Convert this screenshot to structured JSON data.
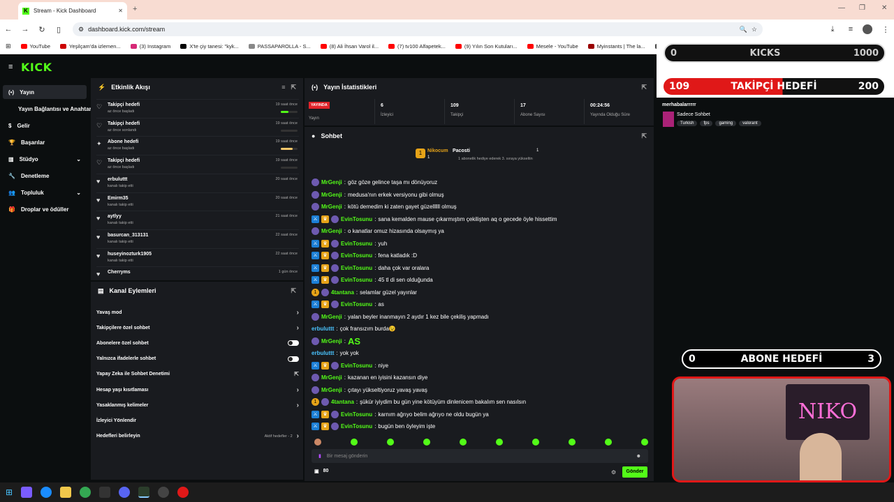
{
  "browser": {
    "tab_title": "Stream - Kick Dashboard",
    "url": "dashboard.kick.com/stream",
    "bookmarks": [
      {
        "label": "YouTube",
        "color": "#ff0000"
      },
      {
        "label": "Yeşilçam'da izlemen...",
        "color": "#c00"
      },
      {
        "label": "(3) Instagram",
        "color": "#d62976"
      },
      {
        "label": "X'te çiy tanesi: \"kyk...",
        "color": "#000"
      },
      {
        "label": "PASSAPAROLLA - S...",
        "color": "#888"
      },
      {
        "label": "(8) Ali İhsan Varol il...",
        "color": "#ff0000"
      },
      {
        "label": "(7) tv100 Alfapetek...",
        "color": "#ff0000"
      },
      {
        "label": "(9) Yılın Son Kutuları...",
        "color": "#ff0000"
      },
      {
        "label": "Mesele - YouTube",
        "color": "#ff0000"
      },
      {
        "label": "Myinstants | The la...",
        "color": "#900"
      },
      {
        "label": "ChatPlay - Twitch &...",
        "color": "#444"
      }
    ]
  },
  "kick": {
    "logo": "KICK",
    "sidebar": [
      "Yayın",
      "Yayın Bağlantısı ve Anahtarı",
      "Gelir",
      "Başarılar",
      "Stüdyo",
      "Denetleme",
      "Topluluk",
      "Droplar ve ödüller"
    ],
    "events_title": "Etkinlik Akışı",
    "events": [
      {
        "name": "Takipçi hedefi",
        "sub": "az önce başladı",
        "time": "19 saat önce",
        "bar": 0.45,
        "bar_color": "#53fc18",
        "icon": "♡"
      },
      {
        "name": "Takipçi hedefi",
        "sub": "az önce sonlandı",
        "time": "19 saat önce",
        "bar": 0,
        "bar_color": "#53fc18",
        "icon": "♡"
      },
      {
        "name": "Abone hedefi",
        "sub": "az önce başladı",
        "time": "19 saat önce",
        "bar": 0.7,
        "bar_color": "#f5c76b",
        "icon": "✦"
      },
      {
        "name": "Takipçi hedefi",
        "sub": "az önce başladı",
        "time": "19 saat önce",
        "bar": 0,
        "bar_color": "#53fc18",
        "icon": "♡"
      },
      {
        "name": "erbuluttt",
        "sub": "kanalı takip etti",
        "time": "20 saat önce",
        "icon": "♥"
      },
      {
        "name": "Emirm35",
        "sub": "kanalı takip etti",
        "time": "20 saat önce",
        "icon": "♥"
      },
      {
        "name": "aytlyy",
        "sub": "kanalı takip etti",
        "time": "21 saat önce",
        "icon": "♥"
      },
      {
        "name": "basurcan_313131",
        "sub": "kanalı takip etti",
        "time": "22 saat önce",
        "icon": "♥"
      },
      {
        "name": "huseyinozturk1905",
        "sub": "kanalı takip etti",
        "time": "22 saat önce",
        "icon": "♥"
      },
      {
        "name": "Cherryms",
        "sub": "",
        "time": "1 gün önce",
        "icon": "♥"
      }
    ],
    "actions_title": "Kanal Eylemleri",
    "actions": [
      {
        "label": "Yavaş mod",
        "type": "chevron"
      },
      {
        "label": "Takipçilere özel sohbet",
        "type": "chevron"
      },
      {
        "label": "Abonelere özel sohbet",
        "type": "toggle"
      },
      {
        "label": "Yalnızca ifadelerle sohbet",
        "type": "toggle"
      },
      {
        "label": "Yapay Zeka ile Sohbet Denetimi",
        "type": "ext"
      },
      {
        "label": "Hesap yaşı kısıtlaması",
        "type": "chevron"
      },
      {
        "label": "Yasaklanmış kelimeler",
        "type": "chevron"
      },
      {
        "label": "İzleyici Yönlendir",
        "type": "none"
      },
      {
        "label": "Hedefleri belirleyin",
        "type": "chevron",
        "extra": "Aktif hedefler - 2"
      }
    ],
    "stats_title": "Yayın İstatistikleri",
    "live_badge": "YAYINDA",
    "live_label": "Yayın",
    "stats": [
      {
        "value": "6",
        "label": "İzleyici"
      },
      {
        "value": "109",
        "label": "Takipçi"
      },
      {
        "value": "17",
        "label": "Abone Sayısı"
      },
      {
        "value": "00:24:56",
        "label": "Yayında Olduğu Süre"
      }
    ],
    "chat_title": "Sohbet",
    "pinned": {
      "user1": "Nikocum",
      "count1": "1",
      "user2": "Pacosti",
      "count2": "1",
      "note": "1 abonelik hediye ederek 3. sıraya yükseltin"
    },
    "messages": [
      {
        "user": "MrGenji",
        "text": "göz göze gelince taşa mı dönüyoruz",
        "badges": "m"
      },
      {
        "user": "MrGenji",
        "text": "medusa'nın erkek versiyonu gibi olmuş",
        "badges": "m"
      },
      {
        "user": "MrGenji",
        "text": "kötü demedim ki zaten gayet güzellllll olmuş",
        "badges": "m"
      },
      {
        "user": "EvinTosunu",
        "text": "sana kemalden mause çıkarmıştım çekilişten aq o gecede öyle hissettim",
        "badges": "e"
      },
      {
        "user": "MrGenji",
        "text": "o kanatlar omuz hizasında olsaymış ya",
        "badges": "m"
      },
      {
        "user": "EvinTosunu",
        "text": "yuh",
        "badges": "e"
      },
      {
        "user": "EvinTosunu",
        "text": "fena katladık :D",
        "badges": "e"
      },
      {
        "user": "EvinTosunu",
        "text": "daha çok var oralara",
        "badges": "e"
      },
      {
        "user": "EvinTosunu",
        "text": "45 tl di sen olduğunda",
        "badges": "e"
      },
      {
        "user": "4tantana",
        "text": "selamlar güzel yayınlar",
        "badges": "t"
      },
      {
        "user": "EvinTosunu",
        "text": "as",
        "badges": "e"
      },
      {
        "user": "MrGenji",
        "text": "yalan beyler inanmayın 2 aydır 1 kez bile çekiliş yapmadı",
        "badges": "m"
      },
      {
        "user": "erbuluttt",
        "text": "çok fransızım burda😉",
        "badges": "n"
      },
      {
        "user": "MrGenji",
        "text": "AS",
        "badges": "m"
      },
      {
        "user": "erbuluttt",
        "text": "yok yok",
        "badges": "n"
      },
      {
        "user": "EvinTosunu",
        "text": "niye",
        "badges": "e"
      },
      {
        "user": "MrGenji",
        "text": "kazanan en iyisini kazansın diye",
        "badges": "m"
      },
      {
        "user": "MrGenji",
        "text": "çıtayı yükseltiyoruz yavaş yavaş",
        "badges": "m"
      },
      {
        "user": "4tantana",
        "text": "şükür iyiydim bu gün yine kötüyüm dinlenicem bakalım sen nasılsın",
        "badges": "t"
      },
      {
        "user": "EvinTosunu",
        "text": "karnım ağrıyo belim ağrıyo ne oldu bugün ya",
        "badges": "e"
      },
      {
        "user": "EvinTosunu",
        "text": "bugün ben öyleyim işte",
        "badges": "e"
      }
    ],
    "chat_placeholder": "Bir mesaj gönderin",
    "points": "80",
    "send": "Gönder"
  },
  "overlay": {
    "kicks": {
      "left": "0",
      "label": "KICKS",
      "right": "1000"
    },
    "follow": {
      "left": "109",
      "label": "TAKİPÇİ HEDEFİ",
      "right": "200"
    },
    "title": "merhabalarrrrr",
    "category": "Sadece Sohbet",
    "tags": [
      "Turkish",
      "fps",
      "gaming",
      "valorant"
    ],
    "sub": {
      "left": "0",
      "label": "ABONE HEDEFİ",
      "right": "3"
    },
    "webcam_sign": "NIKO"
  }
}
